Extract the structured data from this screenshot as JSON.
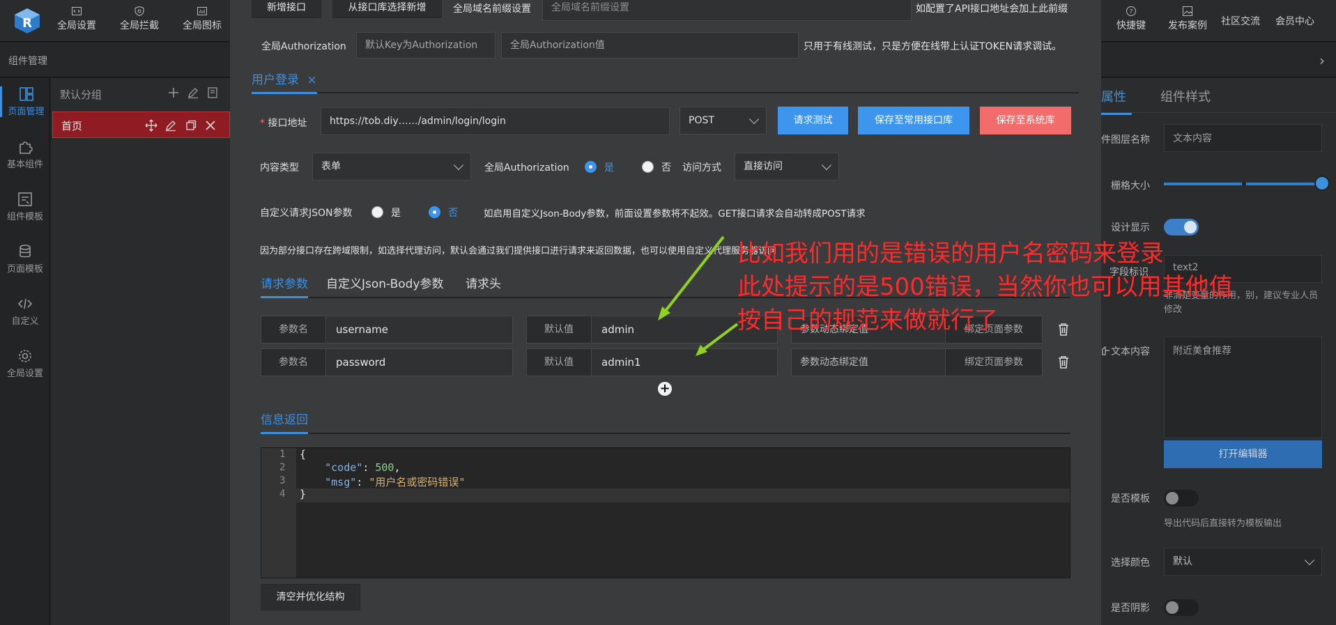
{
  "topbar": {
    "items_left": [
      "全局设置",
      "全局拦截",
      "全局图标"
    ],
    "items_right": [
      "快捷键",
      "发布案例",
      "社区交流",
      "会员中心"
    ]
  },
  "subbar": {
    "title": "组件管理",
    "chevron": "›"
  },
  "rail": {
    "items": [
      {
        "label": "页面管理",
        "icon": "layout-icon"
      },
      {
        "label": "基本组件",
        "icon": "puzzle-icon"
      },
      {
        "label": "组件模板",
        "icon": "template-icon"
      },
      {
        "label": "页面模板",
        "icon": "database-icon"
      },
      {
        "label": "自定义",
        "icon": "code-icon"
      },
      {
        "label": "全局设置",
        "icon": "gear-icon"
      }
    ]
  },
  "pages": {
    "group": "默认分组",
    "page": "首页"
  },
  "modal": {
    "top_buttons": [
      "新增接口",
      "从接口库选择新增"
    ],
    "domain_label": "全局域名前缀设置",
    "domain_placeholder": "全局域名前缀设置",
    "domain_note": "如配置了API接口地址会加上此前缀",
    "auth_label": "全局Authorization",
    "auth_key_placeholder": "默认Key为Authorization",
    "auth_value_placeholder": "全局Authorization值",
    "auth_note": "只用于有线测试，只是方便在线带上认证TOKEN请求调试。",
    "api_tab": "用户登录",
    "api_tab_close": "×",
    "url_label": "接口地址",
    "url_required": "*",
    "url_value": "https://tob.diy……/admin/login/login",
    "method": "POST",
    "btn_test": "请求测试",
    "btn_save_common": "保存至常用接口库",
    "btn_save_system": "保存至系统库",
    "content_type_label": "内容类型",
    "content_type_value": "表单",
    "global_auth_label": "全局Authorization",
    "yes": "是",
    "no": "否",
    "access_label": "访问方式",
    "access_value": "直接访问",
    "json_label": "自定义请求JSON参数",
    "json_note": "如启用自定义Json-Body参数，前面设置参数将不起效。GET接口请求会自动转成POST请求",
    "proxy_note": "因为部分接口存在跨域限制，如选择代理访问，默认会通过我们提供接口进行请求来返回数据，也可以使用自定义代理服务器访问",
    "param_tabs": [
      "请求参数",
      "自定义Json-Body参数",
      "请求头"
    ],
    "params": [
      {
        "name_label": "参数名",
        "name": "username",
        "default_label": "默认值",
        "default": "admin",
        "bind_label": "参数动态绑定值",
        "bind_btn": "绑定页面参数"
      },
      {
        "name_label": "参数名",
        "name": "password",
        "default_label": "默认值",
        "default": "admin1",
        "bind_label": "参数动态绑定值",
        "bind_btn": "绑定页面参数"
      }
    ],
    "add": "+",
    "response_tab": "信息返回",
    "code": {
      "line_numbers": [
        "1",
        "2",
        "3",
        "4"
      ],
      "open": "{",
      "close": "}",
      "code_key": "\"code\"",
      "code_val": "500",
      "msg_key": "\"msg\"",
      "msg_val": "\"用户名或密码错误\""
    },
    "btn_clear": "清空并优化结构"
  },
  "props": {
    "tabs": [
      "属性",
      "组件样式"
    ],
    "layer_label": "件图层名称",
    "layer_value": "文本内容",
    "grid_label": "栅格大小",
    "slider_value": 1.0,
    "design_label": "设计显示",
    "field_label": "字段标识",
    "field_value": "text2",
    "field_note": "非清楚变量的作用，别，建议专业人员修改",
    "text_label": "文本内容",
    "text_value": "附近美食推荐",
    "btn_editor": "打开编辑器",
    "template_label": "是否模板",
    "template_note": "导出代码后直接转为模板输出",
    "color_label": "选择颜色",
    "color_value": "默认",
    "shadow_label": "是否阴影"
  },
  "annotation": {
    "lines": [
      "比如我们用的是错误的用户名密码来登录",
      "此处提示的是500错误，当然你也可以用其他值",
      "按自己的规范来做就行了"
    ]
  },
  "colors": {
    "accent": "#3d8fe0",
    "danger": "#f26c6c",
    "annotation": "#ff2a2a"
  }
}
